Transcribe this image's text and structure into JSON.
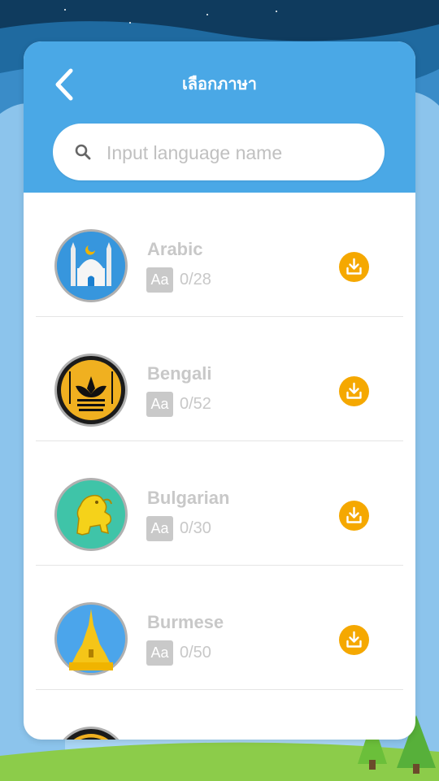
{
  "header": {
    "title": "เลือกภาษา"
  },
  "search": {
    "placeholder": "Input language name",
    "value": ""
  },
  "languages": [
    {
      "name": "Arabic",
      "badge": "Aa",
      "progress": "0/28",
      "icon": "mosque-icon"
    },
    {
      "name": "Bengali",
      "badge": "Aa",
      "progress": "0/52",
      "icon": "water-lily-icon"
    },
    {
      "name": "Bulgarian",
      "badge": "Aa",
      "progress": "0/30",
      "icon": "lion-icon"
    },
    {
      "name": "Burmese",
      "badge": "Aa",
      "progress": "0/50",
      "icon": "pagoda-icon"
    }
  ],
  "colors": {
    "header": "#4aa8e6",
    "accent": "#f5a800",
    "muted_text": "#c8c8c8"
  }
}
